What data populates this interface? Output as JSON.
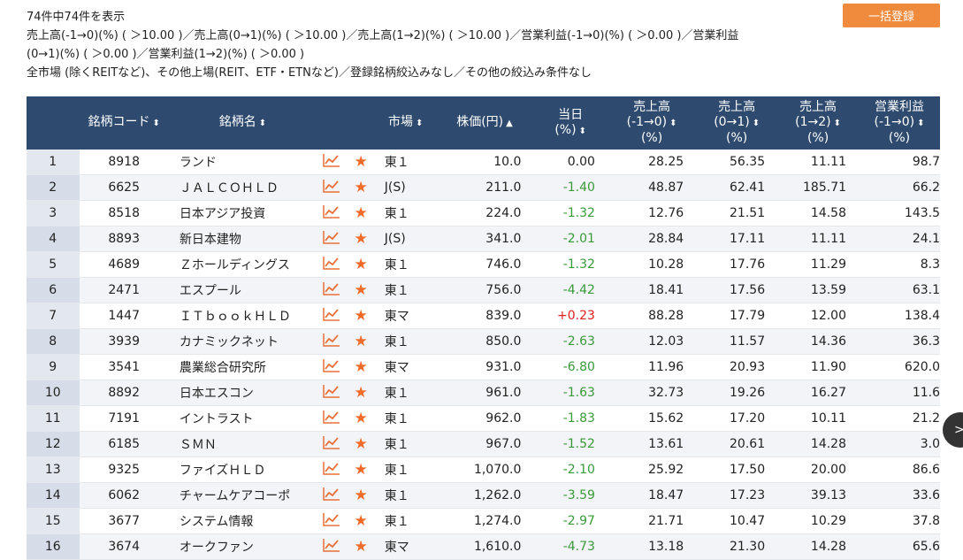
{
  "header": {
    "count_text": "74件中74件を表示",
    "bulk_button": "一括登録",
    "criteria_line1": "売上高(-1→0)(%) ( ＞10.00 )／売上高(0→1)(%) ( ＞10.00 )／売上高(1→2)(%) ( ＞10.00 )／営業利益(-1→0)(%) ( ＞0.00 )／営業利益",
    "criteria_line2": "(0→1)(%) ( ＞0.00 )／営業利益(1→2)(%) ( ＞0.00 )",
    "criteria_line3": "全市場 (除くREITなど)、その他上場(REIT、ETF・ETNなど)／登録銘柄絞込みなし／その他の絞込み条件なし"
  },
  "table": {
    "columns": [
      {
        "l1": "",
        "l2": "",
        "l3": "",
        "sort": ""
      },
      {
        "l1": "銘柄コード",
        "l2": "",
        "l3": "",
        "sort": "⬍"
      },
      {
        "l1": "銘柄名",
        "l2": "",
        "l3": "",
        "sort": "⬍"
      },
      {
        "l1": "",
        "l2": "",
        "l3": "",
        "sort": ""
      },
      {
        "l1": "",
        "l2": "",
        "l3": "",
        "sort": ""
      },
      {
        "l1": "市場",
        "l2": "",
        "l3": "",
        "sort": "⬍"
      },
      {
        "l1": "株価(円)",
        "l2": "",
        "l3": "",
        "sort": "▲"
      },
      {
        "l1": "当日",
        "l2": "(%)",
        "l3": "",
        "sort": "⬍"
      },
      {
        "l1": "売上高",
        "l2": "(-1→0)",
        "l3": "(%)",
        "sort": "⬍"
      },
      {
        "l1": "売上高",
        "l2": "(0→1)",
        "l3": "(%)",
        "sort": "⬍"
      },
      {
        "l1": "売上高",
        "l2": "(1→2)",
        "l3": "(%)",
        "sort": "⬍"
      },
      {
        "l1": "営業利益",
        "l2": "(-1→0)",
        "l3": "(%)",
        "sort": "⬍"
      }
    ],
    "rows": [
      {
        "no": "1",
        "code": "8918",
        "name": "ランド",
        "market": "東１",
        "price": "10.0",
        "change": "0.00",
        "s1": "28.25",
        "s2": "56.35",
        "s3": "11.11",
        "op": "98.7"
      },
      {
        "no": "2",
        "code": "6625",
        "name": "ＪＡＬＣＯＨＬＤ",
        "market": "J(S)",
        "price": "211.0",
        "change": "-1.40",
        "s1": "48.87",
        "s2": "62.41",
        "s3": "185.71",
        "op": "66.2"
      },
      {
        "no": "3",
        "code": "8518",
        "name": "日本アジア投資",
        "market": "東１",
        "price": "224.0",
        "change": "-1.32",
        "s1": "12.76",
        "s2": "21.51",
        "s3": "14.58",
        "op": "143.5"
      },
      {
        "no": "4",
        "code": "8893",
        "name": "新日本建物",
        "market": "J(S)",
        "price": "341.0",
        "change": "-2.01",
        "s1": "28.84",
        "s2": "17.11",
        "s3": "11.11",
        "op": "24.1"
      },
      {
        "no": "5",
        "code": "4689",
        "name": "Ｚホールディングス",
        "market": "東１",
        "price": "746.0",
        "change": "-1.32",
        "s1": "10.28",
        "s2": "17.76",
        "s3": "11.29",
        "op": "8.3"
      },
      {
        "no": "6",
        "code": "2471",
        "name": "エスプール",
        "market": "東１",
        "price": "756.0",
        "change": "-4.42",
        "s1": "18.41",
        "s2": "17.56",
        "s3": "13.59",
        "op": "63.1"
      },
      {
        "no": "7",
        "code": "1447",
        "name": "ＩＴｂｏｏｋＨＬＤ",
        "market": "東マ",
        "price": "839.0",
        "change": "+0.23",
        "s1": "88.28",
        "s2": "17.79",
        "s3": "12.00",
        "op": "138.4"
      },
      {
        "no": "8",
        "code": "3939",
        "name": "カナミックネット",
        "market": "東１",
        "price": "850.0",
        "change": "-2.63",
        "s1": "12.03",
        "s2": "11.57",
        "s3": "14.36",
        "op": "36.3"
      },
      {
        "no": "9",
        "code": "3541",
        "name": "農業総合研究所",
        "market": "東マ",
        "price": "931.0",
        "change": "-6.80",
        "s1": "11.96",
        "s2": "20.93",
        "s3": "11.90",
        "op": "620.0"
      },
      {
        "no": "10",
        "code": "8892",
        "name": "日本エスコン",
        "market": "東１",
        "price": "961.0",
        "change": "-1.63",
        "s1": "32.73",
        "s2": "19.26",
        "s3": "16.27",
        "op": "11.6"
      },
      {
        "no": "11",
        "code": "7191",
        "name": "イントラスト",
        "market": "東１",
        "price": "962.0",
        "change": "-1.83",
        "s1": "15.62",
        "s2": "17.20",
        "s3": "10.11",
        "op": "21.2"
      },
      {
        "no": "12",
        "code": "6185",
        "name": "ＳＭＮ",
        "market": "東１",
        "price": "967.0",
        "change": "-1.52",
        "s1": "13.61",
        "s2": "20.61",
        "s3": "14.28",
        "op": "3.0"
      },
      {
        "no": "13",
        "code": "9325",
        "name": "ファイズＨＬＤ",
        "market": "東１",
        "price": "1,070.0",
        "change": "-2.10",
        "s1": "25.92",
        "s2": "17.50",
        "s3": "20.00",
        "op": "86.6"
      },
      {
        "no": "14",
        "code": "6062",
        "name": "チャームケアコーポ",
        "market": "東１",
        "price": "1,262.0",
        "change": "-3.59",
        "s1": "18.47",
        "s2": "17.23",
        "s3": "39.13",
        "op": "33.6"
      },
      {
        "no": "15",
        "code": "3677",
        "name": "システム情報",
        "market": "東１",
        "price": "1,274.0",
        "change": "-2.97",
        "s1": "21.71",
        "s2": "10.47",
        "s3": "10.29",
        "op": "37.8"
      },
      {
        "no": "16",
        "code": "3674",
        "name": "オークファン",
        "market": "東マ",
        "price": "1,610.0",
        "change": "-4.73",
        "s1": "13.18",
        "s2": "21.30",
        "s3": "14.28",
        "op": "65.6"
      }
    ]
  },
  "icons": {
    "chart": "line-chart-icon",
    "star": "star-icon",
    "scroll": "chevron-right-icon"
  },
  "colors": {
    "header_bg": "#2e4a6f",
    "accent": "#f08a3c",
    "negative": "#3a9a3a",
    "positive": "#e02020",
    "star": "#f06a2a"
  },
  "scroll_glyph": ">"
}
